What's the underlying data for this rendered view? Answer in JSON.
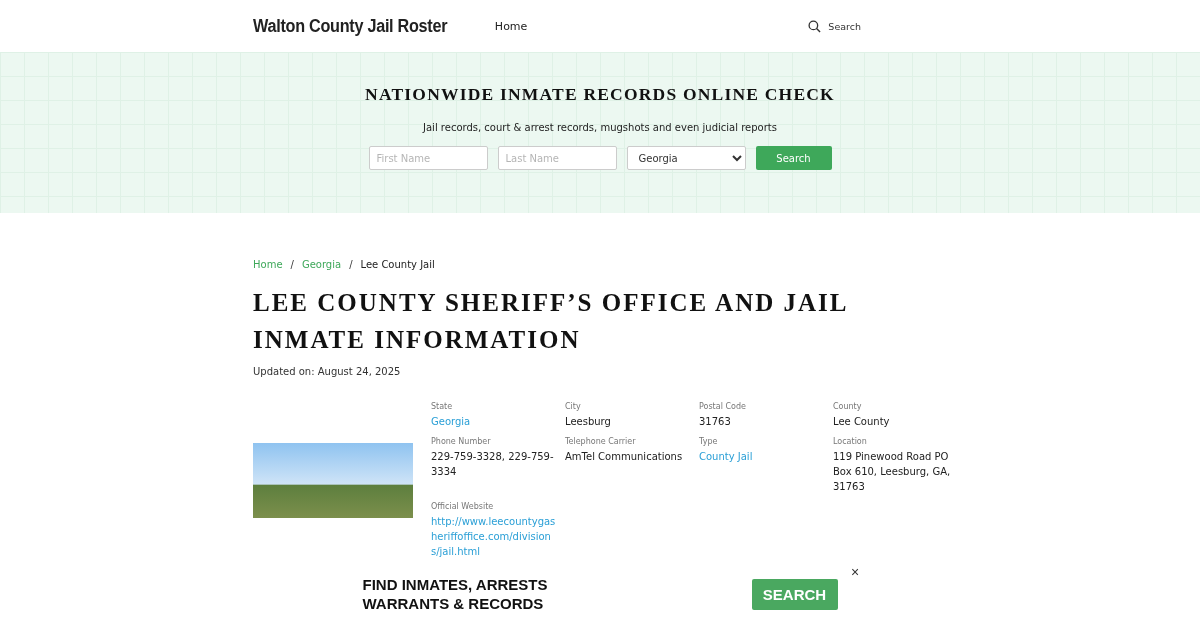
{
  "header": {
    "site_title": "Walton County Jail Roster",
    "nav": [
      "Home"
    ],
    "search_label": "Search"
  },
  "hero": {
    "title": "NATIONWIDE INMATE RECORDS ONLINE CHECK",
    "subtitle": "Jail records, court & arrest records, mugshots and even judicial reports",
    "first_name": {
      "placeholder": "First Name"
    },
    "last_name": {
      "placeholder": "Last Name"
    },
    "state_select": {
      "value": "Georgia"
    },
    "button": "Search"
  },
  "breadcrumb_separator": "/",
  "breadcrumb": [
    {
      "label": "Home",
      "kind": "link"
    },
    {
      "label": "Georgia",
      "kind": "link"
    },
    {
      "label": "Lee County Jail",
      "kind": "current"
    }
  ],
  "page_title": "LEE COUNTY SHERIFF’S OFFICE AND JAIL INMATE INFORMATION",
  "updated": "Updated on: August 24, 2025",
  "facts": [
    {
      "label": "State",
      "value": "Georgia",
      "kind": "link"
    },
    {
      "label": "City",
      "value": "Leesburg",
      "kind": "text"
    },
    {
      "label": "Postal Code",
      "value": "31763",
      "kind": "text"
    },
    {
      "label": "County",
      "value": "Lee County",
      "kind": "text"
    },
    {
      "label": "Phone Number",
      "value": "229-759-3328, 229-759-3334",
      "kind": "text"
    },
    {
      "label": "Telephone Carrier",
      "value": "AmTel Communications",
      "kind": "text"
    },
    {
      "label": "Type",
      "value": "County Jail",
      "kind": "link"
    },
    {
      "label": "Location",
      "value": "119 Pinewood Road PO Box 610, Leesburg, GA, 31763",
      "kind": "text"
    },
    {
      "label": "Official Website",
      "value": "http://www.leecountygasheriffoffice.com/divisions/jail.html",
      "kind": "link"
    }
  ],
  "ad_banner": {
    "headline_lines": [
      "FIND INMATES, ARRESTS",
      "WARRANTS & RECORDS"
    ],
    "button": "SEARCH",
    "close": "×"
  }
}
